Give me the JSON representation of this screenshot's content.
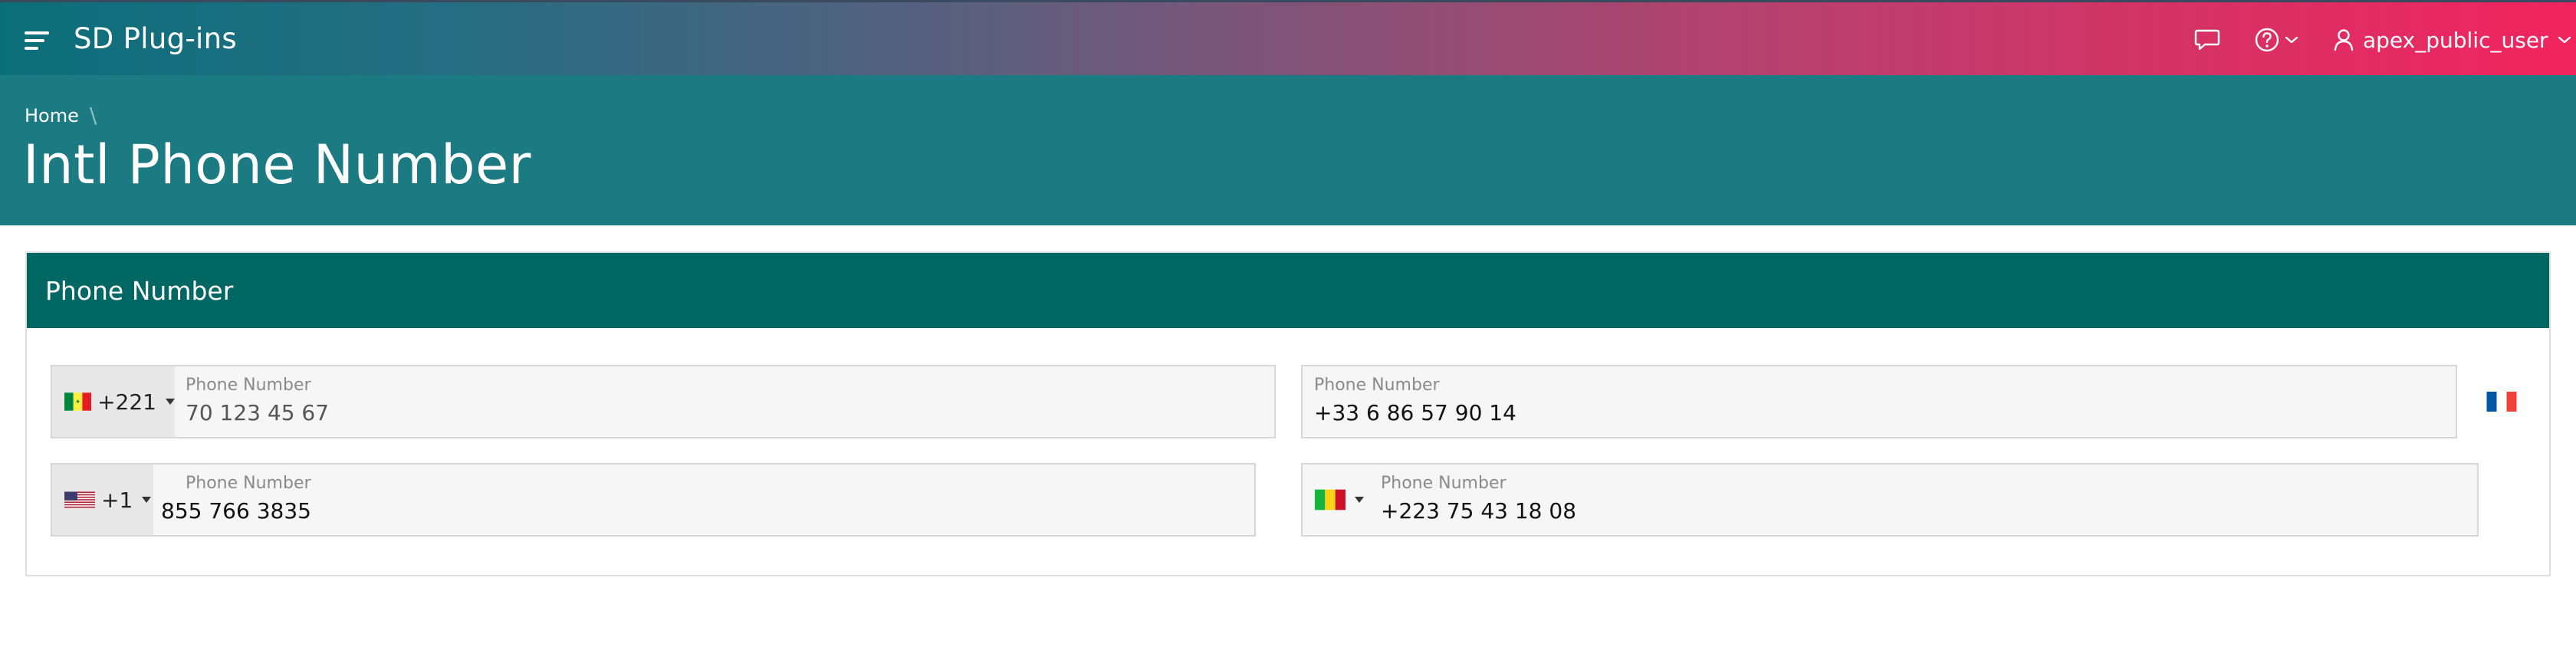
{
  "app": {
    "title": "SD Plug-ins",
    "user_label": "apex_public_user"
  },
  "icons": {
    "menu": "hamburger-menu-icon",
    "chat": "chat-bubble-icon",
    "help": "help-circle-icon",
    "user": "user-icon",
    "chevron": "chevron-down-icon"
  },
  "breadcrumb": {
    "home": "Home",
    "separator": "\\"
  },
  "page": {
    "title": "Intl Phone Number"
  },
  "region": {
    "title": "Phone Number"
  },
  "fields": [
    {
      "flag": "Senegal",
      "dial_code": "+221",
      "label": "Phone Number",
      "value": "70 123 45 67",
      "value_is_placeholder": true
    },
    {
      "flag": "France",
      "dial_code": "",
      "label": "Phone Number",
      "value": "+33 6 86 57 90 14",
      "value_is_placeholder": false
    },
    {
      "flag": "United States",
      "dial_code": "+1",
      "label": "Phone Number",
      "value": "855 766 3835",
      "value_is_placeholder": false
    },
    {
      "flag": "Mali",
      "dial_code": "",
      "label": "Phone Number",
      "value": "+223 75 43 18 08",
      "value_is_placeholder": false
    }
  ],
  "colors": {
    "topbar_gradient_start": "#0b6f7a",
    "topbar_gradient_end": "#f2245f",
    "hero_background": "#1c7a82",
    "region_header": "#006763"
  }
}
